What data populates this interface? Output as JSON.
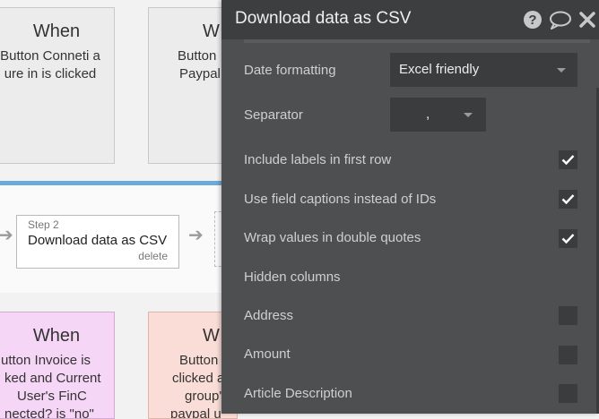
{
  "canvas": {
    "top_cards": [
      {
        "when": "When",
        "desc": "Button Conneti a\nure in is clicked"
      },
      {
        "when": "W",
        "desc": "Button\nPaypal"
      }
    ],
    "step": {
      "number_label": "Step 2",
      "title": "Download data as CSV",
      "delete_label": "delete"
    },
    "bottom_cards": [
      {
        "when": "When",
        "desc": "utton Invoice is\nked and Current\nUser's FinC\nnected? is \"no\""
      },
      {
        "when": "W",
        "desc": "Button\nclicked a\ngroup's\npaypal u"
      }
    ]
  },
  "panel": {
    "title": "Download data as CSV",
    "header_icons": [
      "help-icon",
      "comment-icon",
      "close-icon"
    ],
    "date_formatting": {
      "label": "Date formatting",
      "value": "Excel friendly"
    },
    "separator": {
      "label": "Separator",
      "value": ","
    },
    "options": [
      {
        "label": "Include labels in first row",
        "checked": true
      },
      {
        "label": "Use field captions instead of IDs",
        "checked": true
      },
      {
        "label": "Wrap values in double quotes",
        "checked": true
      }
    ],
    "hidden_columns_label": "Hidden columns",
    "columns": [
      {
        "label": "Address",
        "checked": false
      },
      {
        "label": "Amount",
        "checked": false
      },
      {
        "label": "Article Description",
        "checked": false
      }
    ]
  }
}
